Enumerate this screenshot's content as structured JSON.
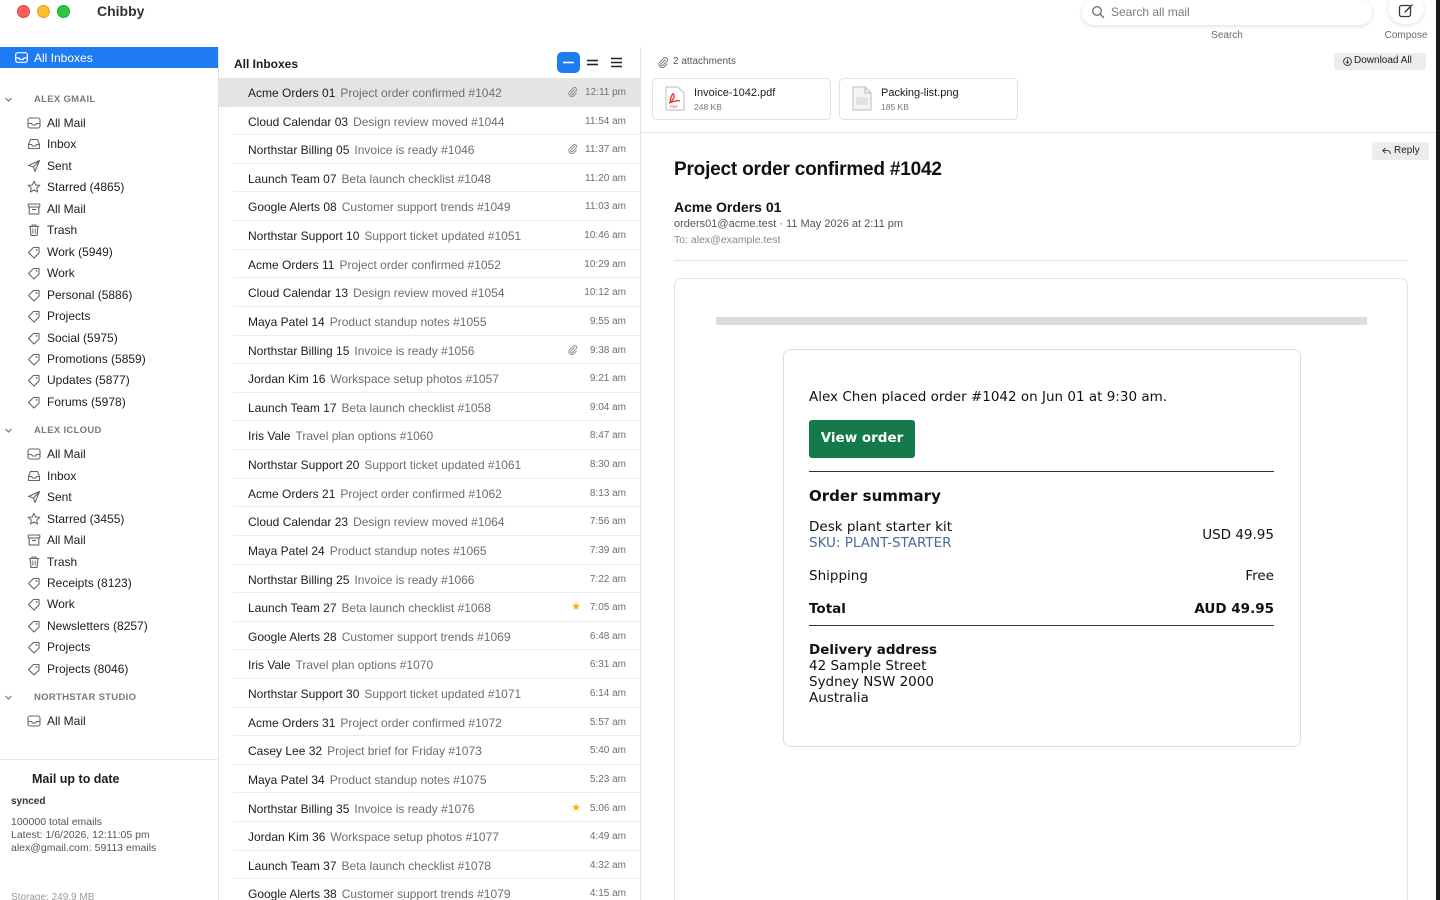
{
  "app": {
    "title": "Chibby"
  },
  "search": {
    "placeholder": "Search all mail",
    "caption": "Search"
  },
  "compose": {
    "caption": "Compose"
  },
  "sidebar": {
    "all_inboxes": "All Inboxes",
    "accounts": [
      {
        "name": "ALEX GMAIL",
        "folders": [
          {
            "label": "All Mail",
            "icon": "tray-icon"
          },
          {
            "label": "Inbox",
            "icon": "inbox-icon"
          },
          {
            "label": "Sent",
            "icon": "paper-plane-icon"
          },
          {
            "label": "Starred  (4865)",
            "icon": "star-icon"
          },
          {
            "label": "All Mail",
            "icon": "archive-icon"
          },
          {
            "label": "Trash",
            "icon": "trash-icon"
          },
          {
            "label": "Work  (5949)",
            "icon": "tag-icon"
          },
          {
            "label": "Work",
            "icon": "tag-icon"
          },
          {
            "label": "Personal  (5886)",
            "icon": "tag-icon"
          },
          {
            "label": "Projects",
            "icon": "tag-icon"
          },
          {
            "label": "Social  (5975)",
            "icon": "tag-icon"
          },
          {
            "label": "Promotions  (5859)",
            "icon": "tag-icon"
          },
          {
            "label": "Updates  (5877)",
            "icon": "tag-icon"
          },
          {
            "label": "Forums  (5978)",
            "icon": "tag-icon"
          }
        ]
      },
      {
        "name": "ALEX ICLOUD",
        "folders": [
          {
            "label": "All Mail",
            "icon": "tray-icon"
          },
          {
            "label": "Inbox",
            "icon": "inbox-icon"
          },
          {
            "label": "Sent",
            "icon": "paper-plane-icon"
          },
          {
            "label": "Starred  (3455)",
            "icon": "star-icon"
          },
          {
            "label": "All Mail",
            "icon": "archive-icon"
          },
          {
            "label": "Trash",
            "icon": "trash-icon"
          },
          {
            "label": "Receipts  (8123)",
            "icon": "tag-icon"
          },
          {
            "label": "Work",
            "icon": "tag-icon"
          },
          {
            "label": "Newsletters  (8257)",
            "icon": "tag-icon"
          },
          {
            "label": "Projects",
            "icon": "tag-icon"
          },
          {
            "label": "Projects  (8046)",
            "icon": "tag-icon"
          }
        ]
      },
      {
        "name": "NORTHSTAR STUDIO",
        "folders": [
          {
            "label": "All Mail",
            "icon": "tray-icon"
          }
        ]
      }
    ],
    "sync": {
      "title": "Mail up to date",
      "status": "synced",
      "total": "100000 total emails",
      "latest": "Latest: 1/6/2026, 12:11:05 pm",
      "account": "alex@gmail.com: 59113 emails",
      "storage": "Storage: 249.9 MB"
    }
  },
  "list": {
    "title": "All Inboxes",
    "messages": [
      {
        "sender": "Acme Orders 01",
        "subject": "Project order confirmed #1042",
        "time": "12:11 pm",
        "attachment": true,
        "starred": false,
        "selected": true
      },
      {
        "sender": "Cloud Calendar 03",
        "subject": "Design review moved #1044",
        "time": "11:54 am",
        "attachment": false,
        "starred": false
      },
      {
        "sender": "Northstar Billing 05",
        "subject": "Invoice is ready #1046",
        "time": "11:37 am",
        "attachment": true,
        "starred": false
      },
      {
        "sender": "Launch Team 07",
        "subject": "Beta launch checklist #1048",
        "time": "11:20 am",
        "attachment": false,
        "starred": false
      },
      {
        "sender": "Google Alerts 08",
        "subject": "Customer support trends #1049",
        "time": "11:03 am",
        "attachment": false,
        "starred": false
      },
      {
        "sender": "Northstar Support 10",
        "subject": "Support ticket updated #1051",
        "time": "10:46 am",
        "attachment": false,
        "starred": false
      },
      {
        "sender": "Acme Orders 11",
        "subject": "Project order confirmed #1052",
        "time": "10:29 am",
        "attachment": false,
        "starred": false
      },
      {
        "sender": "Cloud Calendar 13",
        "subject": "Design review moved #1054",
        "time": "10:12 am",
        "attachment": false,
        "starred": false
      },
      {
        "sender": "Maya Patel 14",
        "subject": "Product standup notes #1055",
        "time": "9:55 am",
        "attachment": false,
        "starred": false
      },
      {
        "sender": "Northstar Billing 15",
        "subject": "Invoice is ready #1056",
        "time": "9:38 am",
        "attachment": true,
        "starred": false
      },
      {
        "sender": "Jordan Kim 16",
        "subject": "Workspace setup photos #1057",
        "time": "9:21 am",
        "attachment": false,
        "starred": false
      },
      {
        "sender": "Launch Team 17",
        "subject": "Beta launch checklist #1058",
        "time": "9:04 am",
        "attachment": false,
        "starred": false
      },
      {
        "sender": "Iris Vale",
        "subject": "Travel plan options #1060",
        "time": "8:47 am",
        "attachment": false,
        "starred": false
      },
      {
        "sender": "Northstar Support 20",
        "subject": "Support ticket updated #1061",
        "time": "8:30 am",
        "attachment": false,
        "starred": false
      },
      {
        "sender": "Acme Orders 21",
        "subject": "Project order confirmed #1062",
        "time": "8:13 am",
        "attachment": false,
        "starred": false
      },
      {
        "sender": "Cloud Calendar 23",
        "subject": "Design review moved #1064",
        "time": "7:56 am",
        "attachment": false,
        "starred": false
      },
      {
        "sender": "Maya Patel 24",
        "subject": "Product standup notes #1065",
        "time": "7:39 am",
        "attachment": false,
        "starred": false
      },
      {
        "sender": "Northstar Billing 25",
        "subject": "Invoice is ready #1066",
        "time": "7:22 am",
        "attachment": false,
        "starred": false
      },
      {
        "sender": "Launch Team 27",
        "subject": "Beta launch checklist #1068",
        "time": "7:05 am",
        "attachment": false,
        "starred": true
      },
      {
        "sender": "Google Alerts 28",
        "subject": "Customer support trends #1069",
        "time": "6:48 am",
        "attachment": false,
        "starred": false
      },
      {
        "sender": "Iris Vale",
        "subject": "Travel plan options #1070",
        "time": "6:31 am",
        "attachment": false,
        "starred": false
      },
      {
        "sender": "Northstar Support 30",
        "subject": "Support ticket updated #1071",
        "time": "6:14 am",
        "attachment": false,
        "starred": false
      },
      {
        "sender": "Acme Orders 31",
        "subject": "Project order confirmed #1072",
        "time": "5:57 am",
        "attachment": false,
        "starred": false
      },
      {
        "sender": "Casey Lee 32",
        "subject": "Project brief for Friday #1073",
        "time": "5:40 am",
        "attachment": false,
        "starred": false
      },
      {
        "sender": "Maya Patel 34",
        "subject": "Product standup notes #1075",
        "time": "5:23 am",
        "attachment": false,
        "starred": false
      },
      {
        "sender": "Northstar Billing 35",
        "subject": "Invoice is ready #1076",
        "time": "5:06 am",
        "attachment": false,
        "starred": true
      },
      {
        "sender": "Jordan Kim 36",
        "subject": "Workspace setup photos #1077",
        "time": "4:49 am",
        "attachment": false,
        "starred": false
      },
      {
        "sender": "Launch Team 37",
        "subject": "Beta launch checklist #1078",
        "time": "4:32 am",
        "attachment": false,
        "starred": false
      },
      {
        "sender": "Google Alerts 38",
        "subject": "Customer support trends #1079",
        "time": "4:15 am",
        "attachment": false,
        "starred": false
      }
    ]
  },
  "reader": {
    "attachments_label": "2 attachments",
    "download_all": "Download All",
    "attachments": [
      {
        "name": "Invoice-1042.pdf",
        "size": "248 KB",
        "type": "pdf"
      },
      {
        "name": "Packing-list.png",
        "size": "185 KB",
        "type": "png"
      }
    ],
    "reply": "Reply",
    "subject": "Project order confirmed #1042",
    "from_name": "Acme Orders 01",
    "from_meta": "orders01@acme.test  ·  11 May 2026 at 2:11 pm",
    "to": "To: alex@example.test",
    "body": {
      "intro": "Alex Chen placed order #1042 on Jun 01 at 9:30 am.",
      "button": "View order",
      "summary_title": "Order summary",
      "item_name": "Desk plant starter kit",
      "item_sku": "SKU: PLANT-STARTER",
      "item_price": "USD 49.95",
      "shipping_label": "Shipping",
      "shipping_value": "Free",
      "total_label": "Total",
      "total_value": "AUD 49.95",
      "delivery_title": "Delivery address",
      "address": [
        "42 Sample Street",
        "Sydney NSW 2000",
        "Australia"
      ]
    }
  },
  "colors": {
    "accent": "#1f7bf2",
    "cta_green": "#147a4a",
    "star": "#f5b400",
    "selected_row": "#e4e4e4"
  }
}
